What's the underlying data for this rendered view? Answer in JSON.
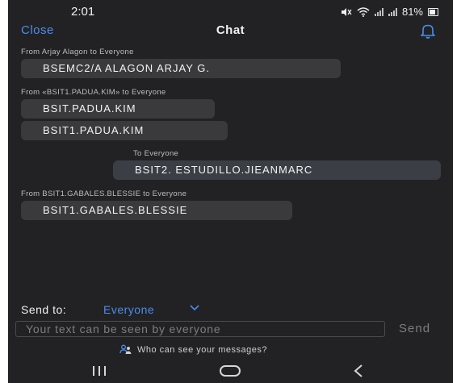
{
  "status_bar": {
    "time": "2:01",
    "battery": "81%",
    "icons": [
      "mute-icon",
      "wifi-icon",
      "signal-icon",
      "signal-icon",
      "battery-icon"
    ]
  },
  "header": {
    "close_label": "Close",
    "title": "Chat",
    "bell_icon": "bell-icon"
  },
  "messages": [
    {
      "sender": "From Arjay Alagon to Everyone",
      "bubbles": [
        "BSEMC2/A ALAGON ARJAY G."
      ]
    },
    {
      "sender": "From «BSIT1.PADUA.KIM» to Everyone",
      "bubbles": [
        "BSIT.PADUA.KIM",
        "BSIT1.PADUA.KIM"
      ]
    },
    {
      "sender": "To Everyone",
      "bubbles": [
        "BSIT2. ESTUDILLO.JIEANMARC"
      ]
    },
    {
      "sender": "From BSIT1.GABALES.BLESSIE to Everyone",
      "bubbles": [
        "BSIT1.GABALES.BLESSIE"
      ]
    }
  ],
  "composer": {
    "send_to_label": "Send to:",
    "send_to_value": "Everyone",
    "input_placeholder": "Your text can be seen by everyone",
    "input_value": "",
    "send_label": "Send",
    "who_can_see": "Who can see your messages?"
  },
  "colors": {
    "accent": "#4a8dec",
    "background": "#222224",
    "bubble": "#3a3a3d"
  },
  "nav": {
    "icons": [
      "recent-apps-icon",
      "home-icon",
      "back-icon"
    ]
  }
}
